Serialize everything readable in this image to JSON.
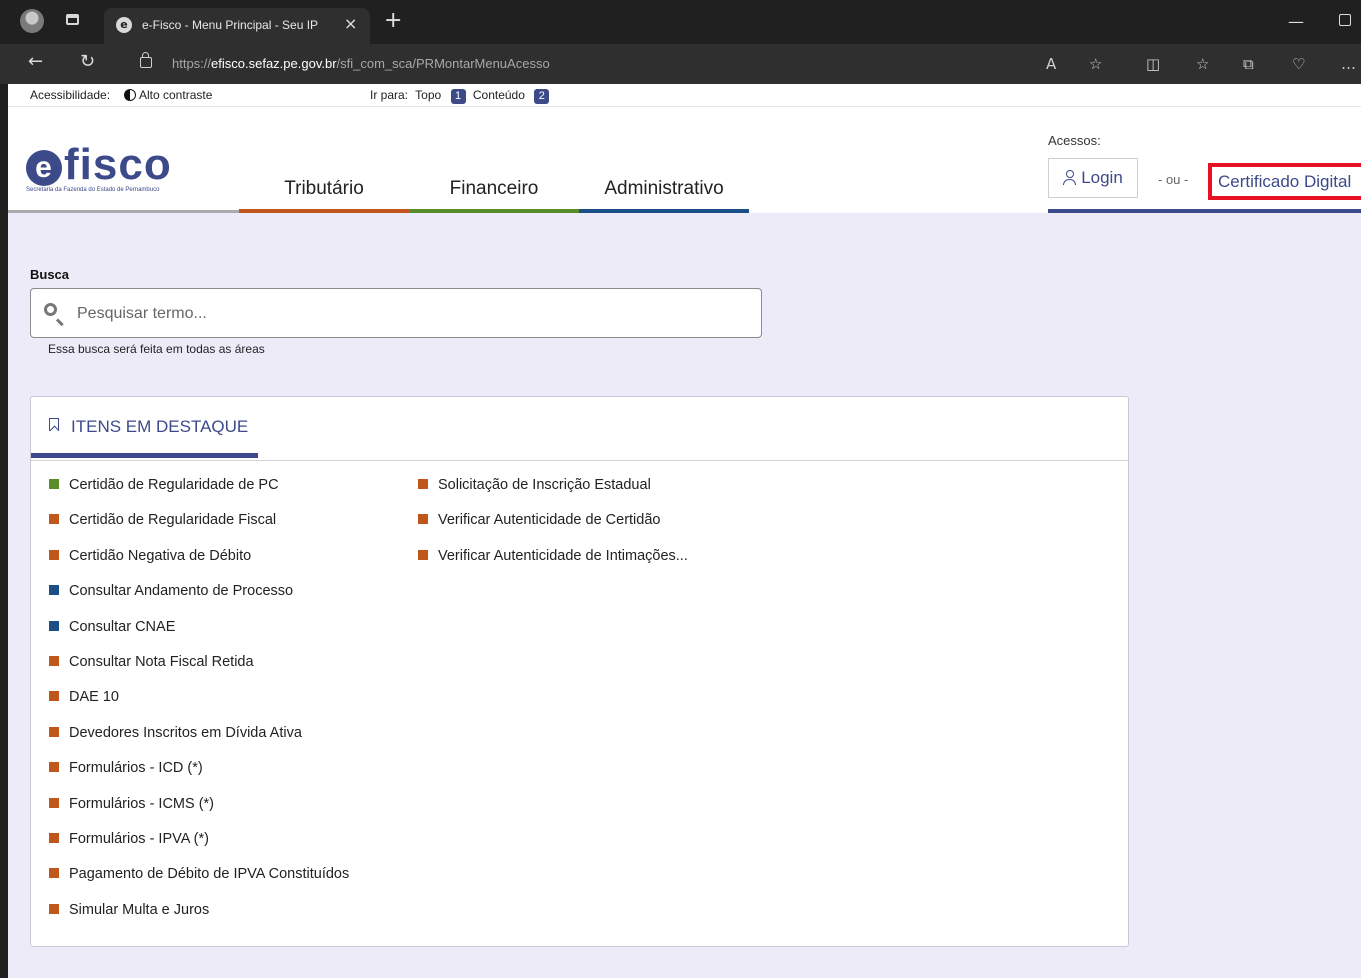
{
  "browser": {
    "tab_title": "e-Fisco - Menu Principal - Seu IP",
    "tab_close": "×",
    "new_tab": "+",
    "url_protocol": "https://",
    "url_domain": "efisco.sefaz.pe.gov.br",
    "url_path": "/sfi_com_sca/PRMontarMenuAcesso"
  },
  "accessibility": {
    "label": "Acessibilidade:",
    "contrast": "Alto contraste",
    "goto_label": "Ir para:",
    "top": "Topo",
    "top_num": "1",
    "content": "Conteúdo",
    "content_num": "2"
  },
  "header": {
    "logo_text": "fisco",
    "logo_e": "e",
    "logo_sub": "Secretaria da Fazenda do Estado de Pernambuco",
    "nav": [
      {
        "label": "Tributário",
        "color": "#c0561b"
      },
      {
        "label": "Financeiro",
        "color": "#5b8c2a"
      },
      {
        "label": "Administrativo",
        "color": "#1a4e86"
      }
    ],
    "acessos_label": "Acessos:",
    "login": "Login",
    "or": "- ou -",
    "cert": "Certificado Digital"
  },
  "search": {
    "label": "Busca",
    "placeholder": "Pesquisar termo...",
    "hint": "Essa busca será feita em todas as áreas"
  },
  "destaque": {
    "title": "ITENS EM DESTAQUE",
    "col1": [
      {
        "label": "Certidão de Regularidade de PC",
        "color": "#5b8c2a"
      },
      {
        "label": "Certidão de Regularidade Fiscal",
        "color": "#c0561b"
      },
      {
        "label": "Certidão Negativa de Débito",
        "color": "#c0561b"
      },
      {
        "label": "Consultar Andamento de Processo",
        "color": "#1a4e86"
      },
      {
        "label": "Consultar CNAE",
        "color": "#1a4e86"
      },
      {
        "label": "Consultar Nota Fiscal Retida",
        "color": "#c0561b"
      },
      {
        "label": "DAE 10",
        "color": "#c0561b"
      },
      {
        "label": "Devedores Inscritos em Dívida Ativa",
        "color": "#c0561b"
      },
      {
        "label": "Formulários - ICD (*)",
        "color": "#c0561b"
      },
      {
        "label": "Formulários - ICMS (*)",
        "color": "#c0561b"
      },
      {
        "label": "Formulários - IPVA (*)",
        "color": "#c0561b"
      },
      {
        "label": "Pagamento de Débito de IPVA Constituídos",
        "color": "#c0561b"
      },
      {
        "label": "Simular Multa e Juros",
        "color": "#c0561b"
      }
    ],
    "col2": [
      {
        "label": "Solicitação de Inscrição Estadual",
        "color": "#c0561b"
      },
      {
        "label": "Verificar Autenticidade de Certidão",
        "color": "#c0561b"
      },
      {
        "label": "Verificar Autenticidade de Intimações...",
        "color": "#c0561b"
      }
    ]
  }
}
